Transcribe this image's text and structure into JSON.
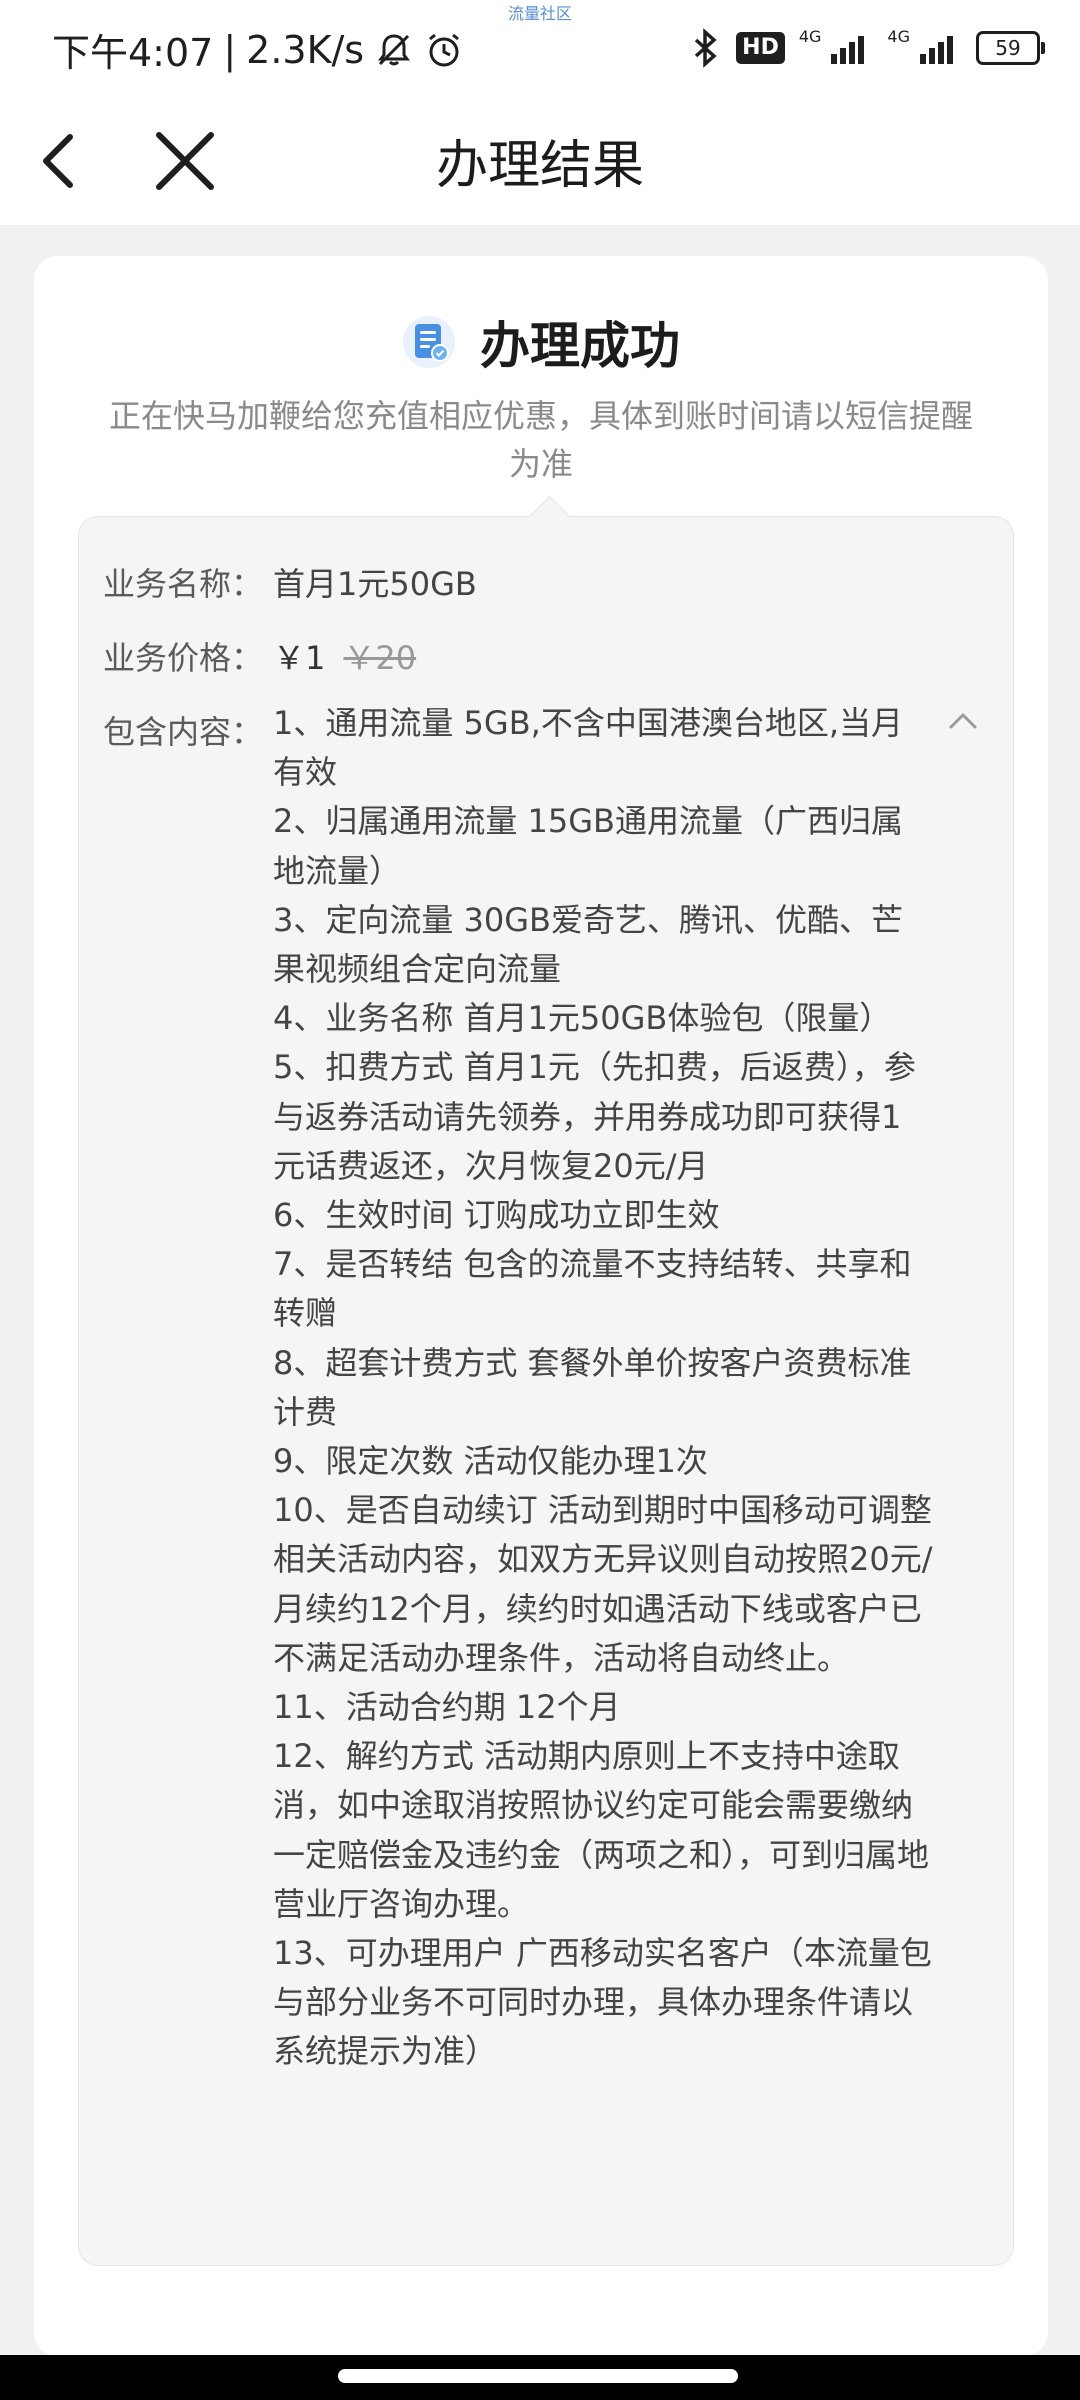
{
  "status_bar": {
    "time": "下午4:07",
    "separator": "|",
    "speed": "2.3K/s",
    "watermark": "流量社区",
    "hd_badge": "HD",
    "network1": "4G",
    "network2": "4G",
    "battery": "59",
    "icons": [
      "mute-bell-icon",
      "alarm-icon",
      "bluetooth-icon",
      "signal-icon",
      "battery-icon"
    ]
  },
  "nav": {
    "title": "办理结果",
    "back_icon": "chevron-left-icon",
    "close_icon": "close-icon"
  },
  "result": {
    "title": "办理成功",
    "icon": "document-check-icon",
    "description": "正在快马加鞭给您充值相应优惠，具体到账时间请以短信提醒为准"
  },
  "details": {
    "name_label": "业务名称：",
    "name_value": "首月1元50GB",
    "price_label": "业务价格：",
    "price_now": "￥1",
    "price_old": "￥20",
    "content_label": "包含内容：",
    "collapse_icon": "chevron-up-icon",
    "content_items": [
      "1、通用流量 5GB,不含中国港澳台地区,当月有效",
      "2、归属通用流量 15GB通用流量（广西归属地流量）",
      "3、定向流量 30GB爱奇艺、腾讯、优酷、芒果视频组合定向流量",
      "4、业务名称 首月1元50GB体验包（限量）",
      "5、扣费方式 首月1元（先扣费，后返费），参与返券活动请先领券，并用券成功即可获得1元话费返还，次月恢复20元/月",
      "6、生效时间 订购成功立即生效",
      "7、是否转结 包含的流量不支持结转、共享和转赠",
      "8、超套计费方式 套餐外单价按客户资费标准计费",
      "9、限定次数 活动仅能办理1次",
      "10、是否自动续订 活动到期时中国移动可调整相关活动内容，如双方无异议则自动按照20元/月续约12个月，续约时如遇活动下线或客户已不满足活动办理条件，活动将自动终止。",
      "11、活动合约期 12个月",
      "12、解约方式 活动期内原则上不支持中途取消，如中途取消按照协议约定可能会需要缴纳一定赔偿金及违约金（两项之和），可到归属地营业厅咨询办理。",
      "13、可办理用户 广西移动实名客户（本流量包与部分业务不可同时办理，具体办理条件请以系统提示为准）"
    ]
  },
  "colors": {
    "accent_blue": "#4a90e2",
    "background": "#f1f1f3",
    "card": "#ffffff",
    "muted_text": "#8a8a8a"
  }
}
